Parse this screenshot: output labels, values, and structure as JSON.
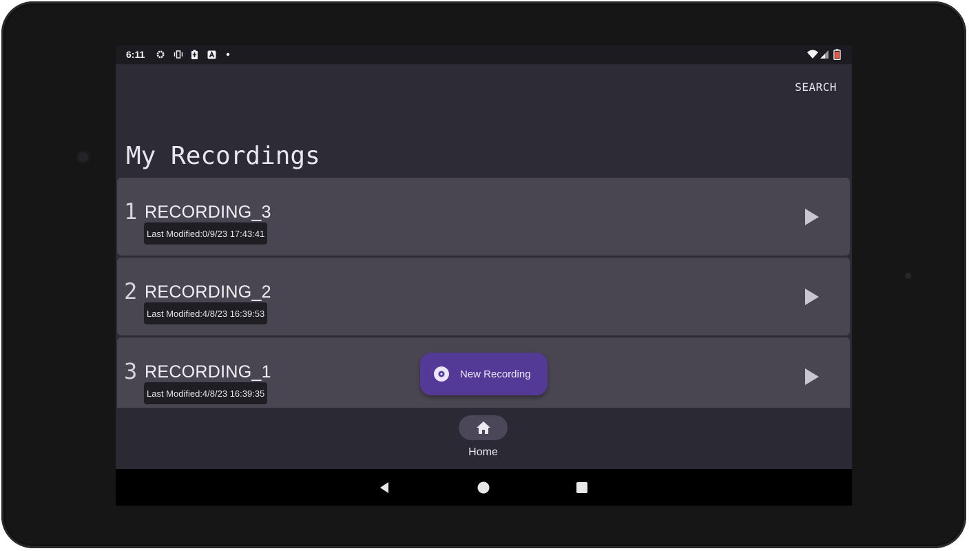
{
  "status_bar": {
    "time": "6:11",
    "icons": [
      "gear-icon",
      "vibrate-icon",
      "battery-saver-icon",
      "a-notification-icon",
      "dot-icon",
      "wifi-icon",
      "signal-icon",
      "battery-low-icon"
    ]
  },
  "app_bar": {
    "search_label": "SEARCH",
    "title": "My Recordings"
  },
  "recordings": [
    {
      "number": "1",
      "name": "RECORDING_3",
      "modified": "Last Modified:0/9/23 17:43:41"
    },
    {
      "number": "2",
      "name": "RECORDING_2",
      "modified": "Last Modified:4/8/23 16:39:53"
    },
    {
      "number": "3",
      "name": "RECORDING_1",
      "modified": "Last Modified:4/8/23 16:39:35"
    }
  ],
  "fab": {
    "label": "New Recording",
    "icon": "record-disc-icon"
  },
  "bottom_nav": {
    "items": [
      {
        "label": "Home",
        "icon": "home-icon",
        "selected": true
      }
    ]
  },
  "system_nav": {
    "icons": [
      "back-icon",
      "home-circle-icon",
      "recents-icon"
    ]
  },
  "colors": {
    "fab": "#523a96",
    "row": "#4a4651",
    "background": "#2d2b36"
  }
}
